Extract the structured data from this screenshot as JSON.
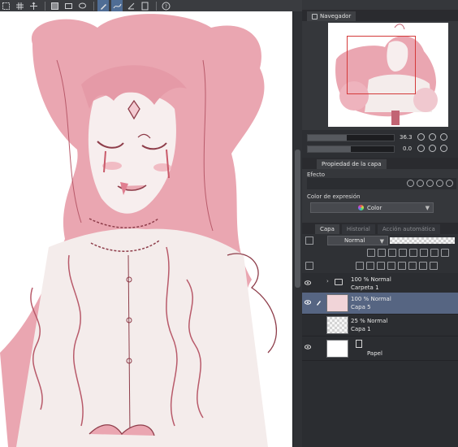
{
  "panels": {
    "navigator_tab": "Navegador",
    "layer_property_tab": "Propiedad de la capa",
    "layer_tab": "Capa",
    "history_tab": "Historial",
    "auto_actions_tab": "Acción automática"
  },
  "navigator": {
    "zoom_value": "36.3",
    "rotation_value": "0.0"
  },
  "layer_property": {
    "effect_label": "Efecto",
    "expression_color_label": "Color de expresión",
    "expression_color_value": "Color"
  },
  "layer_panel": {
    "blend_mode": "Normal"
  },
  "layers": [
    {
      "line1": "100 % Normal",
      "line2": "Carpeta 1",
      "type": "folder",
      "selected": false
    },
    {
      "line1": "100 % Normal",
      "line2": "Capa 5",
      "type": "raster",
      "selected": true
    },
    {
      "line1": "25 % Normal",
      "line2": "Capa 1",
      "type": "raster",
      "selected": false
    },
    {
      "line1": "",
      "line2": "Papel",
      "type": "paper",
      "selected": false
    }
  ],
  "icons": [
    "rectangle-select-icon",
    "grid-icon",
    "transform-icon",
    "fill-icon",
    "lasso-icon",
    "pen-icon",
    "line-icon",
    "rule-icon",
    "text-icon",
    "help-icon",
    "eye-icon",
    "folder-icon",
    "paper-icon"
  ],
  "colors": {
    "sketch_pink": "#e9a8b2",
    "line_dark": "#8e3d4a",
    "nav_frame": "#d43a3a",
    "selected_layer": "#566582",
    "panel_bg": "#35373b"
  }
}
